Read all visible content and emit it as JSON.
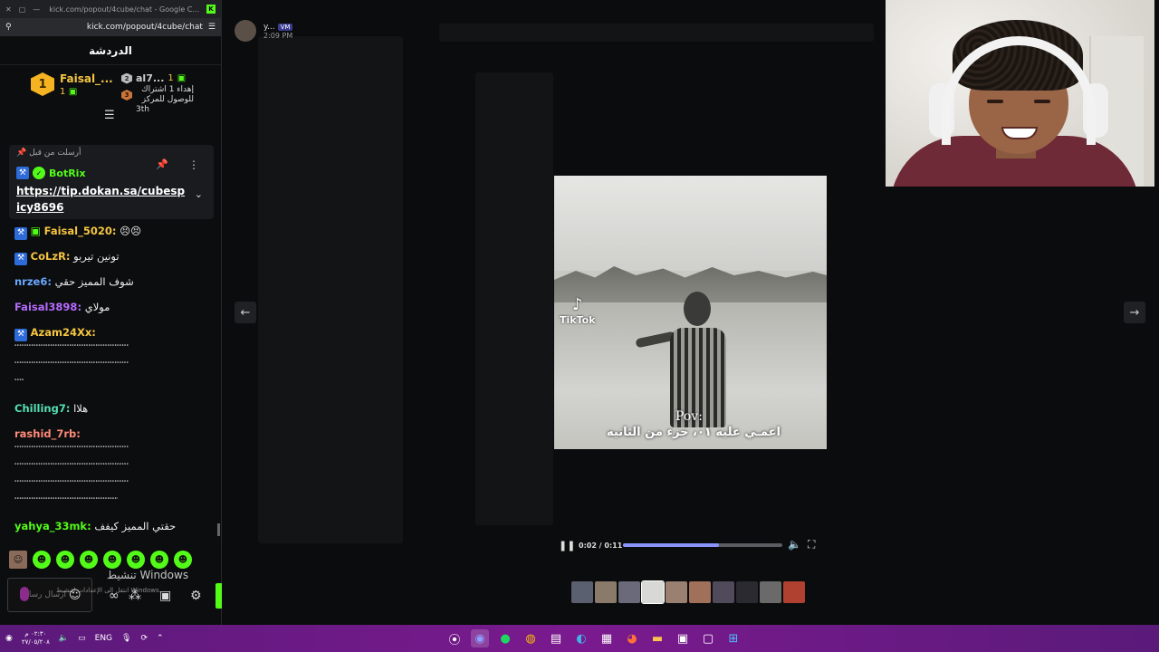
{
  "browser": {
    "tab_title": "kick.com/popout/4cube/chat - Google C...",
    "url": "kick.com/popout/4cube/chat"
  },
  "chat": {
    "header": "الدردشة",
    "leaderboard": {
      "first": {
        "rank": "1",
        "name": "Faisal_...",
        "count": "1"
      },
      "second": {
        "rank": "2",
        "name": "al7...",
        "count": "1"
      },
      "third": {
        "rank": "3",
        "text": "إهداء 1 اشتراك للوصول للمركز",
        "place": "3th"
      }
    },
    "pinned": {
      "label": "أرسلت من قبل",
      "user": "BotRix",
      "link": "https://tip.dokan.sa/cubespicy8696"
    },
    "messages": [
      {
        "user": "Faisal_5020:",
        "text": "😣😣",
        "color": "#f5c542"
      },
      {
        "user": "CoLzR:",
        "text": "تونين تيربو",
        "color": "#f5c542"
      },
      {
        "user": "nrze6:",
        "text": "شوف المميز حقي",
        "color": "#6aa8ff"
      },
      {
        "user": "Faisal3898:",
        "text": "مولاي",
        "color": "#b46bff"
      },
      {
        "user": "Azam24Xx:",
        "text": "",
        "color": "#f5c542"
      },
      {
        "user": "Chilling7:",
        "text": "هلاا",
        "color": "#53e0b0"
      },
      {
        "user": "rashid_7rb:",
        "text": "",
        "color": "#ff8a7a"
      },
      {
        "user": "yahya_33mk:",
        "text": "حقتي المميز كيفف",
        "color": "#53fc18"
      }
    ],
    "spam_line": "ٴٴٴٴٴٴٴٴٴٴٴٴٴٴٴٴٴٴٴٴٴٴٴٴٴٴٴٴٴٴٴٴٴٴٴٴٴٴٴٴٴٴٴٴٴٴٴٴ",
    "input_placeholder": "ارسال رسالة",
    "watermark": "تنشيط Windows",
    "watermark_sub": "انتقل إلى الإعدادات لتنشيط Windows."
  },
  "viewer": {
    "poster_name": "y...",
    "poster_badge": "VM",
    "poster_time": "2:09 PM",
    "video": {
      "tiktok_label": "TikTok",
      "caption_top": "Pov:",
      "caption_bottom": "اغمـي عليه ٠١، جزء من الثانيه",
      "time": "0:02 / 0:11",
      "progress": 0.6
    }
  },
  "taskbar": {
    "lang": "ENG",
    "clock_time": "٠٢:٣٠ م",
    "clock_date": "٢٧/٠٥/٢٠٨"
  },
  "colors": {
    "kick_green": "#53fc18",
    "taskbar": "#7a1a8e",
    "progress": "#8a94ff"
  }
}
